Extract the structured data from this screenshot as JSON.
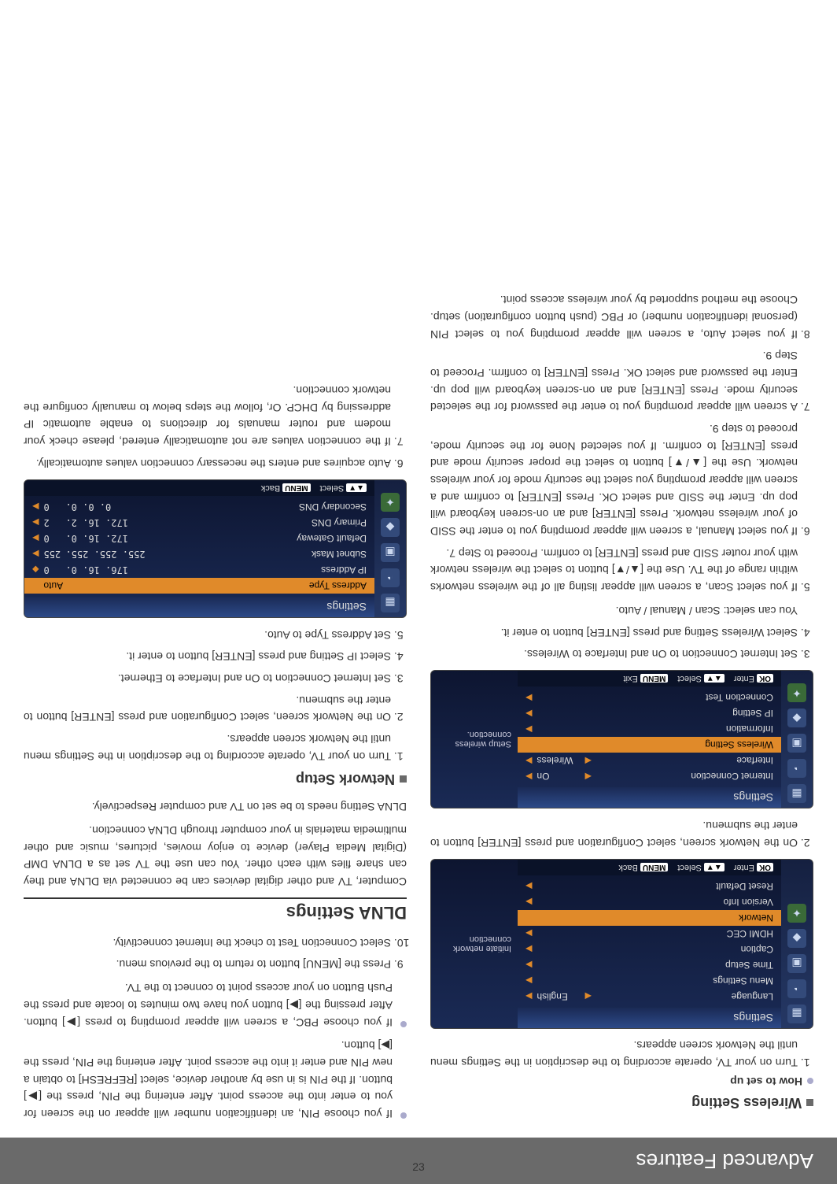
{
  "header": "Advanced Features",
  "pagenum": "23",
  "left": {
    "wireless_title": "Wireless Setting",
    "howto": "How to set up",
    "steps_a": [
      "Turn on your TV, operate according to the description in the Settings menu until the Network screen appears.",
      "On the Network screen, select Configuration and press [ENTER] button to enter the submenu.",
      "Set Internet Connection to On and Interface to Wireless.",
      "Select Wireless Setting and press [ENTER] button to enter it.",
      "If you select Scan, a screen will appear listing all of the wireless networks within range of the TV. Use the [▲/▼] button to select the wireless network with your router SSID and press [ENTER] to confirm. Proceed to Step 7.",
      "If you select Manual, a screen will appear prompting you to enter the SSID of your wireless network. Press [ENTER] and an on-screen keyboard will pop up. Enter the SSID and select OK. Press [ENTER] to confirm and a screen will appear prompting you select the security mode for your wireless network. Use the [▲/▼] button to select the proper security mode and press [ENTER] to confirm. If you selected None for the security mode, proceed to step 9.",
      "A screen will appear prompting you to enter the password for the selected security mode. Press [ENTER] and an on-screen keyboard will pop up. Enter the password and select OK. Press [ENTER] to confirm. Proceed to Step 9.",
      "If you select Auto, a screen will appear prompting you to select PIN (personal identification number) or PBC (push button configuration) setup. Choose the method supported by your wireless access point."
    ],
    "youcan": "You can select: Scan / Manual / Auto.",
    "osd1": {
      "title": "Settings",
      "rows": [
        {
          "lab": "Language",
          "val": "English",
          "kind": "lr"
        },
        {
          "lab": "Menu Settings",
          "kind": "r"
        },
        {
          "lab": "Time Setup",
          "kind": "r"
        },
        {
          "lab": "Caption",
          "kind": "r"
        },
        {
          "lab": "HDMI CEC",
          "kind": "r"
        },
        {
          "lab": "Network",
          "kind": "r",
          "hl": true
        },
        {
          "lab": "Version Info",
          "kind": "r"
        },
        {
          "lab": "Reset Default",
          "kind": "r"
        }
      ],
      "hint": "Initiate network connection",
      "foot": [
        [
          "OK",
          "Enter"
        ],
        [
          "▲▼",
          "Select"
        ],
        [
          "MENU",
          "Back"
        ]
      ]
    },
    "osd2": {
      "title": "Settings",
      "rows": [
        {
          "lab": "Internet Connection",
          "val": "On",
          "kind": "lr"
        },
        {
          "lab": "Interface",
          "val": "Wireless",
          "kind": "lr"
        },
        {
          "lab": "Wireless Setting",
          "kind": "r",
          "hl": true
        },
        {
          "lab": "Information",
          "kind": "r"
        },
        {
          "lab": "IP Setting",
          "kind": "r"
        },
        {
          "lab": "Connection Test",
          "kind": "r"
        }
      ],
      "hint": "Setup wireless connection.",
      "foot": [
        [
          "OK",
          "Enter"
        ],
        [
          "▲▼",
          "Select"
        ],
        [
          "MENU",
          "Exit"
        ]
      ]
    }
  },
  "right": {
    "pin_txt": "If you choose PIN, an identification number will appear on the screen for you to enter into the access point. After entering the PIN, press the [▶] button. If the PIN is in use by another device, select [REFRESH] to obtain a new PIN and enter it into the access point. After entering the PIN, press the [▶] button.",
    "pbc_txt": "If you choose PBC, a screen will appear prompting to press [▶] button. After pressing the [▶] button you have two minutes to locate and press the Push Button on your access point to connect to the TV.",
    "s9": "Press the [MENU] button to return to the previous menu.",
    "s10": "Select Connection Test to check the Internet connectivity.",
    "dlna_title": "DLNA Settings",
    "dlna_p1": "Computer, TV and other digital devices can be connected via DLNA and they can share files with each other. You can use the TV set as a DLNA DMP (Digital Media Player) device to enjoy movies, pictures, music and other multimedia materials in your computer through DLNA connection.",
    "dlna_p2": "DLNA Setting needs to be set on TV and computer Respectively.",
    "net_title": "Network Setup",
    "net_steps": [
      "Turn on your TV, operate according to the description in the Settings menu until the Network screen appears.",
      "On the Network screen, select Configuration and press [ENTER] button to enter the submenu.",
      "Set Internet Connection to On and Interface to Ethernet.",
      "Select IP Setting and press [ENTER] button to enter it.",
      "Set Address Type to Auto.",
      "Auto acquires and enters the necessary connection values automatically.",
      "If the connection values are not automatically entered, please check your modem and router manuals for directions to enable automatic IP addressing by DHCP. Or, follow the steps below to manually configure the network connection."
    ],
    "osd3": {
      "title": "Settings",
      "rows": [
        {
          "lab": "Address Type",
          "val": "Auto",
          "kind": "lr",
          "hl": true
        },
        {
          "lab": "IP Address",
          "val": "176.   16.     0.",
          "ext": "0",
          "dot": true
        },
        {
          "lab": "Subnet Mask",
          "val": "255. 255. 255.",
          "ext": "255",
          "r": true
        },
        {
          "lab": "Default Gateway",
          "val": "172.   16.     0.",
          "ext": "0",
          "r": true
        },
        {
          "lab": "Primary DNS",
          "val": "172.   16.     2.",
          "ext": "2",
          "r": true
        },
        {
          "lab": "Secondary DNS",
          "val": "  0.     0.     0.",
          "ext": "0",
          "r": true
        }
      ],
      "foot": [
        [
          "▲▼",
          "Select"
        ],
        [
          "MENU",
          "Back"
        ]
      ]
    }
  }
}
